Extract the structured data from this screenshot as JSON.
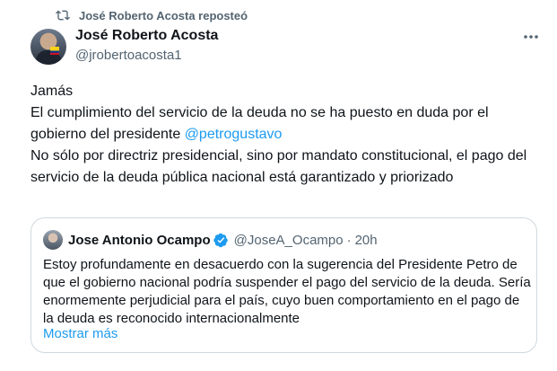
{
  "repost": {
    "label": "José Roberto Acosta reposteó",
    "icon": "repost-icon"
  },
  "author": {
    "name": "José Roberto Acosta",
    "handle": "@jrobertoacosta1",
    "avatar": "avatar"
  },
  "more_icon": "more-icon",
  "tweet": {
    "line1": "Jamás",
    "line2": "El cumplimiento del servicio de la deuda no se ha puesto en duda por el gobierno del presidente ",
    "mention": "@petrogustavo",
    "line3": "No sólo por directriz presidencial, sino por mandato constitucional, el pago del servicio de la deuda pública nacional está garantizado y priorizado"
  },
  "quote": {
    "name": "Jose Antonio Ocampo",
    "verified_icon": "verified-badge-icon",
    "handle": "@JoseA_Ocampo",
    "separator": "·",
    "time": "20h",
    "text": "Estoy profundamente en desacuerdo con la sugerencia del Presidente Petro de que el gobierno nacional podría suspender el pago del servicio de la deuda. Sería enormemente perjudicial para el país, cuyo buen comportamiento en el pago de la deuda es reconocido internacionalmente",
    "show_more": "Mostrar más"
  },
  "colors": {
    "link": "#1d9bf0",
    "secondary_text": "#536471",
    "primary_text": "#0f1419",
    "border": "#cfd9de"
  }
}
